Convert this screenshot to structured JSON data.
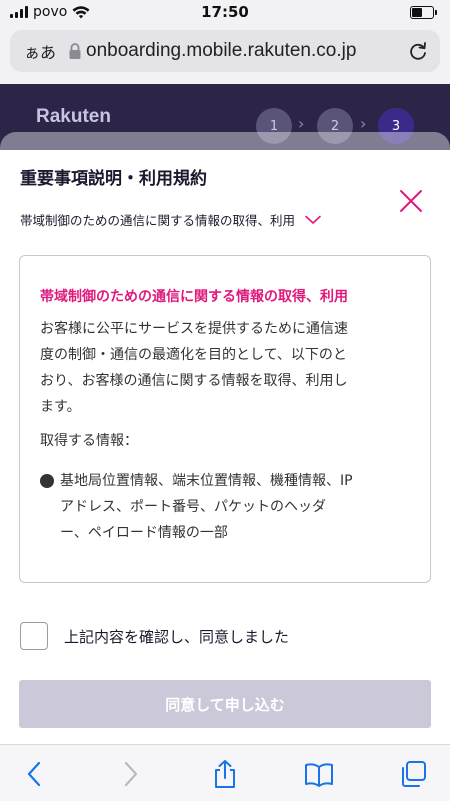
{
  "status_bar": {
    "carrier": "povo",
    "time": "17:50",
    "battery_level": 0.55
  },
  "url_bar": {
    "text_size_label": "ぁあ",
    "url": "onboarding.mobile.rakuten.co.jp"
  },
  "background_page": {
    "logo": "Rakuten",
    "steps": [
      "1",
      "2",
      "3"
    ],
    "active_step": "3"
  },
  "modal": {
    "title": "重要事項説明・利用規約",
    "section_dropdown": "帯域制御のための通信に関する情報の取得、利用",
    "content": {
      "heading": "帯域制御のための通信に関する情報の取得、利用",
      "paragraph_lines": [
        "お客様に公平にサービスを提供するために通信速",
        "度の制御・通信の最適化を目的として、以下のと",
        "おり、お客様の通信に関する情報を取得、利用し",
        "ます。"
      ],
      "subheading": "取得する情報：",
      "bullet_lines": [
        "基地局位置情報、端末位置情報、機種情報、IP",
        "アドレス、ポート番号、パケットのヘッダ",
        "ー、ペイロード情報の一部"
      ]
    },
    "consent_label": "上記内容を確認し、同意しました",
    "consent_checked": false,
    "submit_label": "同意して申し込む",
    "submit_enabled": false
  },
  "toolbar": {
    "icons": [
      "back-icon",
      "forward-icon",
      "share-icon",
      "bookmarks-icon",
      "tabs-icon"
    ]
  },
  "colors": {
    "accent": "#e0197d",
    "page_header": "#2c2548",
    "disabled_button": "#cbc9d9"
  }
}
